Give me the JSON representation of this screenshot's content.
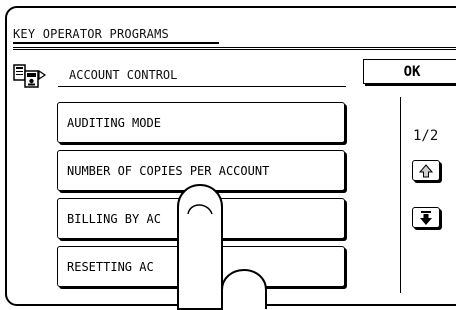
{
  "screen": {
    "title": "KEY OPERATOR PROGRAMS",
    "section_title": "ACCOUNT CONTROL",
    "ok_label": "OK"
  },
  "menu": {
    "items": [
      {
        "label": "AUDITING MODE"
      },
      {
        "label": "NUMBER OF COPIES PER ACCOUNT"
      },
      {
        "label": "BILLING BY AC"
      },
      {
        "label": "RESETTING AC"
      }
    ]
  },
  "pager": {
    "indicator": "1/2",
    "up_icon": "arrow-up-icon",
    "down_icon": "arrow-down-icon"
  },
  "colors": {
    "line": "#000000",
    "background": "#ffffff",
    "up_arrow_fill": "#cfcfcf"
  }
}
